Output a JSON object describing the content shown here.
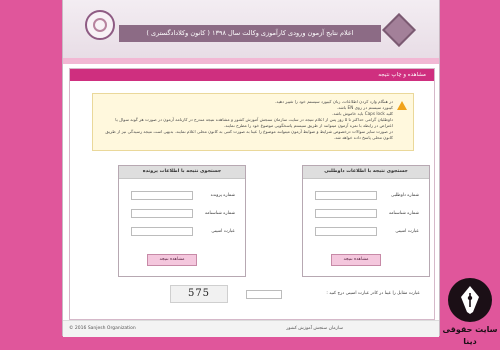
{
  "header": {
    "title": "اعلام نتایج آزمون ورودی کارآموزی وکالت سال ۱۳۹۸ ( کانون وکلادادگستری )"
  },
  "section": {
    "title": "مشاهده و چاپ نتیجه"
  },
  "notice": {
    "items": [
      "در هنگام وارد کردن اطلاعات، زبان کیبورد سیستم خود را تغییر دهید.",
      "کیبورد سیستم در روی EN باشد.",
      "کلید Caps lock باید خاموش باشد.",
      "داوطلبان گرامی حداکثر تا ۵ روز پس از اعلام نتیجه در سایت سازمان سنجش آموزش کشور و مشاهده نتیجه مندرج در کارنامه آزمون در صورت هر گونه سوال یا اعتراض در رابطه با نمره آزمون میتوانند از طریق سیستم پاسخگویی موضوع خود را مطرح نمایند.",
      "در صورت سایر سوالات درخصوص شرایط و ضوابط آزمون میتوانند موضوع را عینا به صورت کتبی به کانون محلی اعلام نمایند. بدیهی است نتیجه رسیدگی نیز از طریق کانون محلی پاسخ داده خواهد شد."
    ]
  },
  "search_by_volunteer": {
    "title": "جستجوی نتیجه با اطلاعات داوطلبی",
    "fields": [
      {
        "label": "شماره داوطلبی",
        "value": ""
      },
      {
        "label": "شماره شناسنامه",
        "value": ""
      },
      {
        "label": "عبارت امنیتی",
        "value": ""
      }
    ],
    "button": "مشاهده نتیجه"
  },
  "search_by_file": {
    "title": "جستجوی نتیجه با اطلاعات پرونده",
    "fields": [
      {
        "label": "شماره پرونده",
        "value": ""
      },
      {
        "label": "شماره شناسنامه",
        "value": ""
      },
      {
        "label": "عبارت امنیتی",
        "value": ""
      }
    ],
    "button": "مشاهده نتیجه"
  },
  "captcha": {
    "label": "عبارت مقابل را عینا در کادر عبارت امنیتی درج کنید :",
    "code": "575",
    "value": ""
  },
  "footer": {
    "copyright": "© 2016 Sanjesh Organization",
    "org": "سازمان سنجش آموزش کشور"
  },
  "watermark": {
    "line1": "سایت حقوقی",
    "line2": "دینا"
  },
  "colors": {
    "background": "#e0569b",
    "section_header": "#cf2f7f",
    "title_banner": "#8c6b85",
    "button": "#f4c7dd"
  }
}
